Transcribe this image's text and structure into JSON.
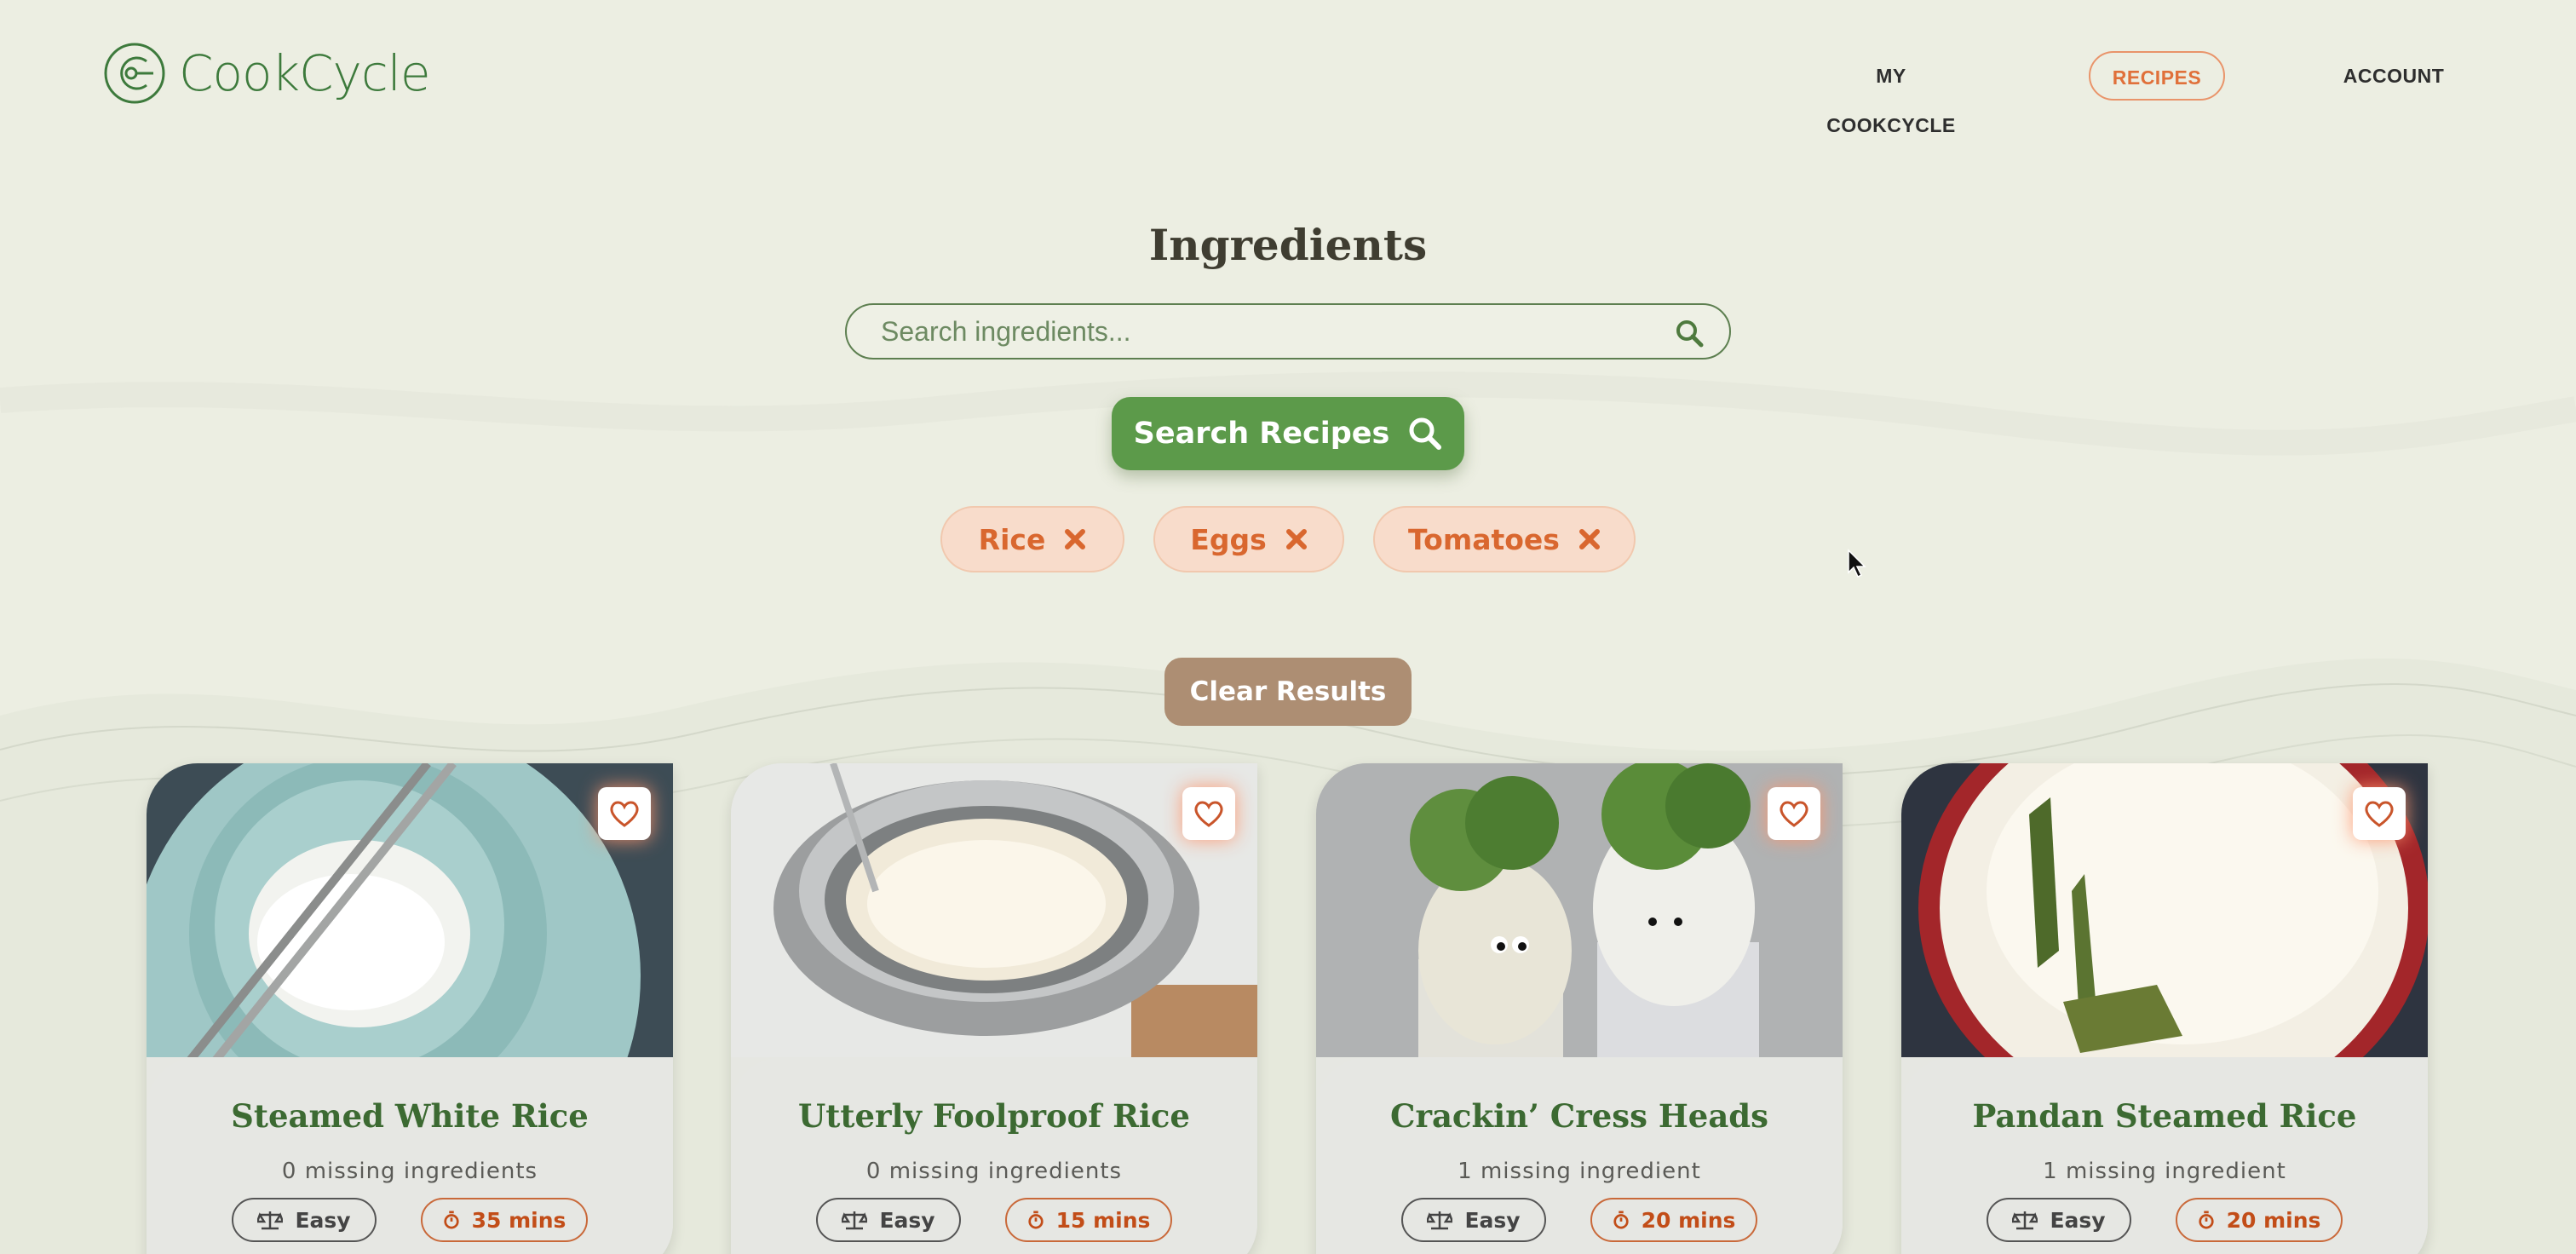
{
  "brand": {
    "name": "CookCycle",
    "accent": "#3d7a3c"
  },
  "nav": {
    "my_cookcycle": "MY COOKCYCLE",
    "recipes": "RECIPES",
    "account": "ACCOUNT"
  },
  "ingredients": {
    "heading": "Ingredients",
    "search_placeholder": "Search ingredients...",
    "search_value": "",
    "search_button": "Search Recipes",
    "chips": [
      "Rice",
      "Eggs",
      "Tomatoes"
    ],
    "clear_button": "Clear Results"
  },
  "colors": {
    "primary_green": "#5c9a4a",
    "chip_bg": "#f8dccb",
    "chip_text": "#d9672f",
    "clear_bg": "#ad8e73"
  },
  "recipes": [
    {
      "title": "Steamed White Rice",
      "missing": "0 missing ingredients",
      "difficulty": "Easy",
      "time": "35 mins",
      "icon": "heart-icon"
    },
    {
      "title": "Utterly Foolproof Rice",
      "missing": "0 missing ingredients",
      "difficulty": "Easy",
      "time": "15 mins",
      "icon": "heart-icon"
    },
    {
      "title": "Crackin’ Cress Heads",
      "missing": "1 missing ingredient",
      "difficulty": "Easy",
      "time": "20 mins",
      "icon": "heart-icon"
    },
    {
      "title": "Pandan Steamed Rice",
      "missing": "1 missing ingredient",
      "difficulty": "Easy",
      "time": "20 mins",
      "icon": "heart-icon"
    }
  ]
}
